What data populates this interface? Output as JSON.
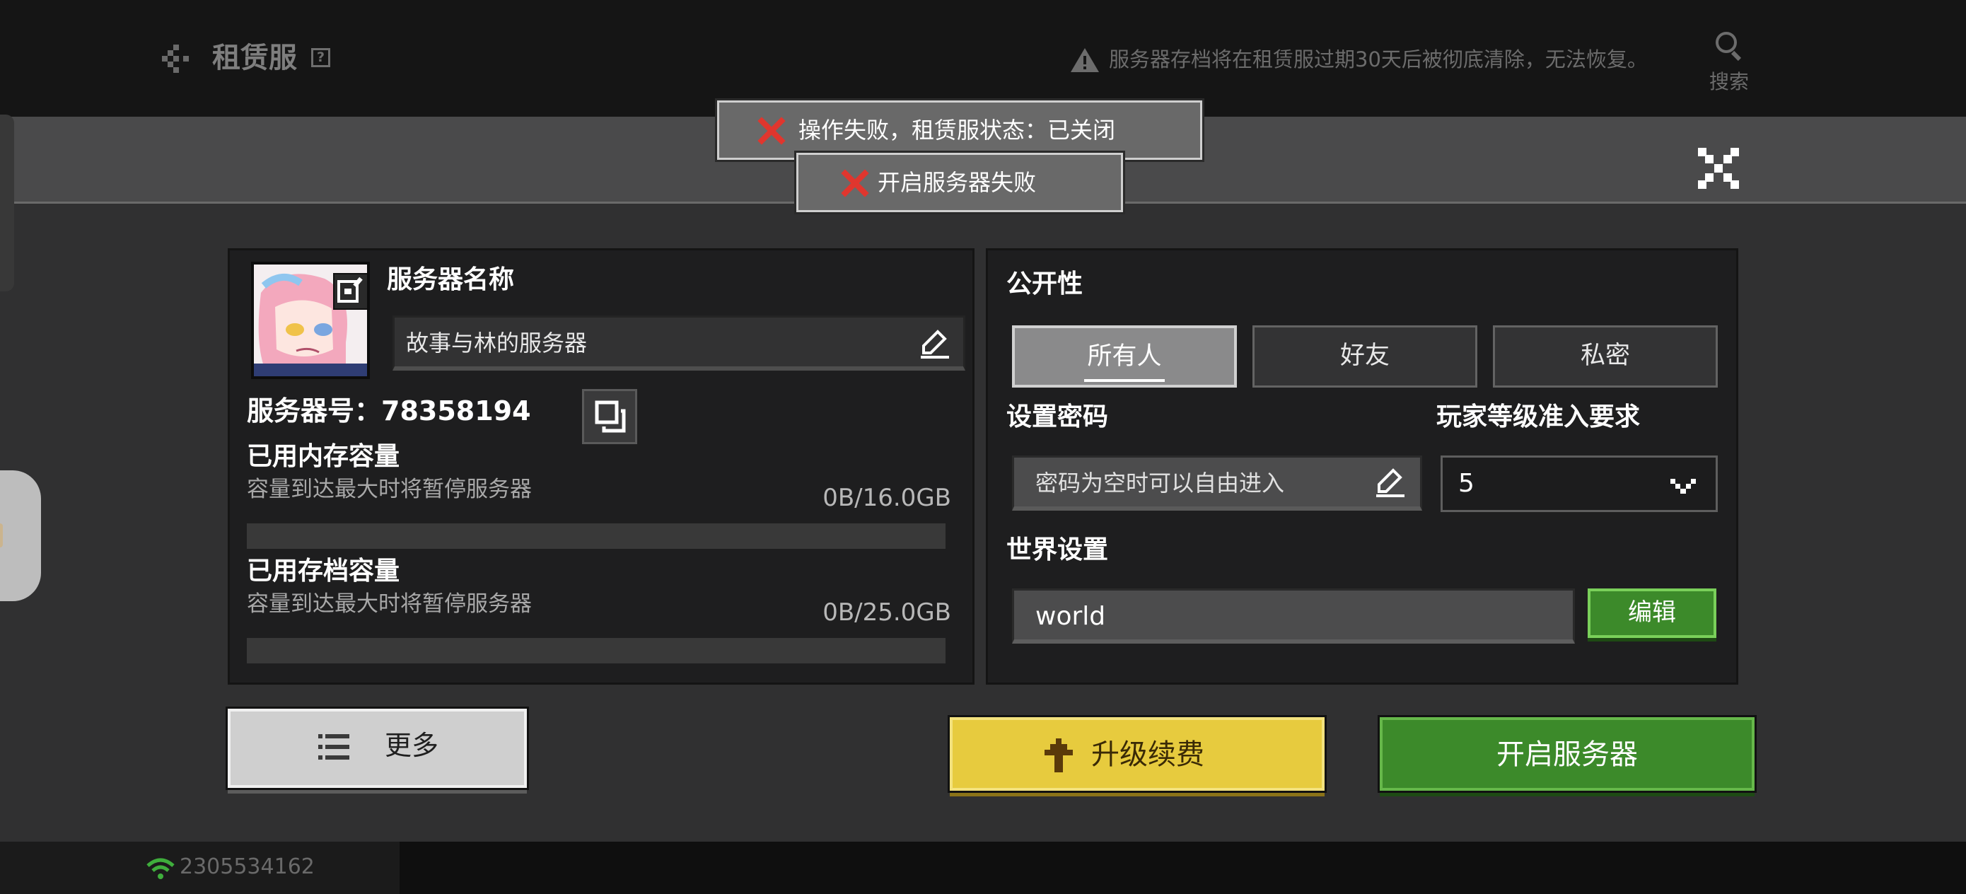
{
  "header": {
    "title": "租赁服",
    "help_glyph": "?",
    "warning_text": "服务器存档将在租赁服过期30天后被彻底清除，无法恢复。",
    "search_label": "搜索"
  },
  "toasts": [
    {
      "text": "操作失败，租赁服状态：已关闭"
    },
    {
      "text": "开启服务器失败"
    }
  ],
  "server_info": {
    "name_label": "服务器名称",
    "name_value": "故事与林的服务器",
    "id_label": "服务器号：78358194",
    "memory": {
      "title": "已用内存容量",
      "hint": "容量到达最大时将暂停服务器",
      "value": "0B/16.0GB",
      "fraction": 0
    },
    "storage": {
      "title": "已用存档容量",
      "hint": "容量到达最大时将暂停服务器",
      "value": "0B/25.0GB",
      "fraction": 0
    }
  },
  "settings": {
    "visibility_label": "公开性",
    "visibility_options": [
      "所有人",
      "好友",
      "私密"
    ],
    "visibility_selected": "所有人",
    "password_label": "设置密码",
    "password_placeholder": "密码为空时可以自由进入",
    "level_label": "玩家等级准入要求",
    "level_value": "5",
    "world_label": "世界设置",
    "world_value": "world",
    "world_edit_label": "编辑"
  },
  "actions": {
    "more_label": "更多",
    "renew_label": "升级续费",
    "start_label": "开启服务器"
  },
  "status_bar": {
    "account_id": "2305534162"
  },
  "colors": {
    "accent_green": "#3c8a2a",
    "accent_yellow": "#e7cb3e",
    "error_red": "#e0362e"
  },
  "icons": {
    "back": "back-arrow-icon",
    "help": "help-icon",
    "warning": "warning-icon",
    "search": "search-icon",
    "close": "close-icon",
    "edit": "pencil-icon",
    "copy": "copy-icon",
    "chevron": "chevron-down-icon",
    "more": "list-icon",
    "renew": "up-arrow-icon",
    "wifi": "wifi-icon",
    "error": "error-x-icon"
  }
}
